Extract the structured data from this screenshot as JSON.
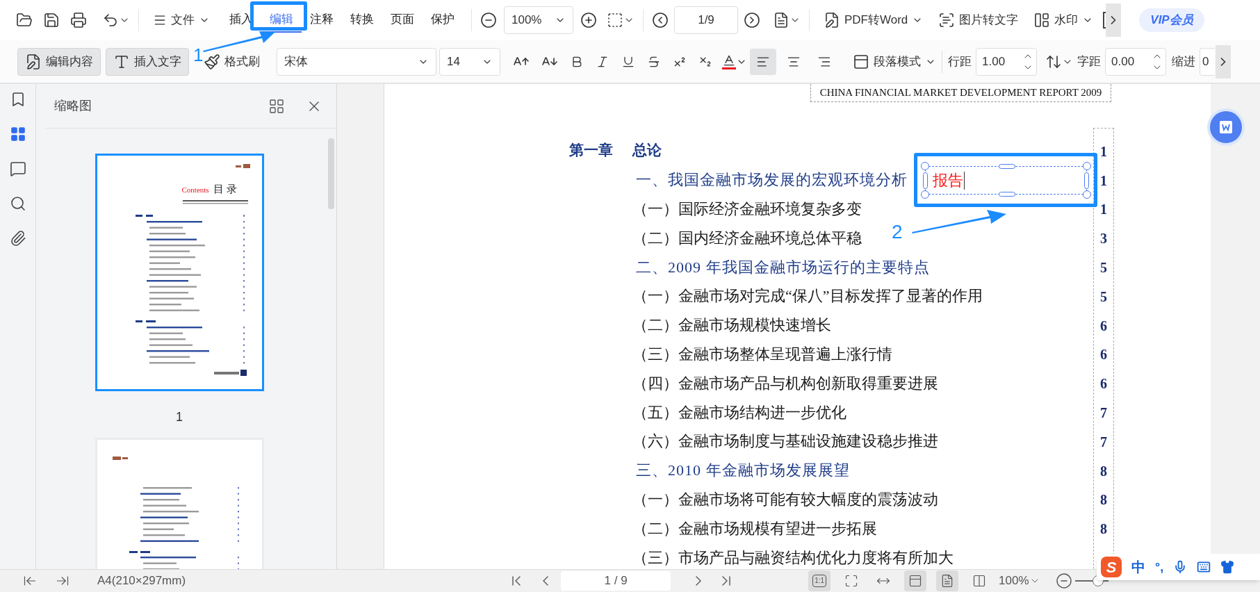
{
  "menu": {
    "label": "文件"
  },
  "tabs": [
    {
      "label": "插入",
      "selected": false
    },
    {
      "label": "编辑",
      "selected": true
    },
    {
      "label": "注释",
      "selected": false
    },
    {
      "label": "转换",
      "selected": false
    },
    {
      "label": "页面",
      "selected": false
    },
    {
      "label": "保护",
      "selected": false
    }
  ],
  "zoom": {
    "value": "100%"
  },
  "page_nav": {
    "value": "1/9"
  },
  "tools": [
    {
      "label": "PDF转Word",
      "kind": "word"
    },
    {
      "label": "图片转文字",
      "kind": "ocr"
    },
    {
      "label": "水印",
      "kind": "watermark"
    }
  ],
  "vip": {
    "label": "VIP会员"
  },
  "edit_bar": {
    "modes": [
      {
        "label": "编辑内容",
        "kind": "edit",
        "pressed": true
      },
      {
        "label": "插入文字",
        "kind": "text",
        "pressed": true
      }
    ],
    "format_painter": "格式刷",
    "font": "宋体",
    "size": "14",
    "alignment": [
      {
        "kind": "left",
        "selected": true
      },
      {
        "kind": "center",
        "selected": false
      },
      {
        "kind": "right",
        "selected": false
      }
    ],
    "paragraph_mode": "段落模式",
    "line_spacing": {
      "label": "行距",
      "value": "1.00"
    },
    "char_spacing": {
      "label": "字距",
      "value": "0.00"
    },
    "indent": {
      "label": "缩进",
      "value": "0"
    }
  },
  "sidebar": {
    "items": [
      {
        "kind": "bookmark",
        "selected": false
      },
      {
        "kind": "thumbnails",
        "selected": true
      },
      {
        "kind": "comments",
        "selected": false
      },
      {
        "kind": "search",
        "selected": false
      },
      {
        "kind": "attachments",
        "selected": false
      }
    ]
  },
  "thumbnail_panel": {
    "title": "缩略图",
    "pages": [
      {
        "label": "1",
        "selected": true,
        "heading": "Contents",
        "heading_cn": "目 录"
      },
      {
        "selected": false
      }
    ]
  },
  "document": {
    "header": "CHINA FINANCIAL MARKET DEVELOPMENT REPORT 2009",
    "toc": [
      {
        "kind": "chapter",
        "number": "第一章",
        "title": "总论",
        "page": "1"
      },
      {
        "kind": "section",
        "title": "一、我国金融市场发展的宏观环境分析",
        "page": "1"
      },
      {
        "kind": "subsection",
        "title": "（一）国际经济金融环境复杂多变",
        "page": "1"
      },
      {
        "kind": "subsection",
        "title": "（二）国内经济金融环境总体平稳",
        "page": "3"
      },
      {
        "kind": "section",
        "title": "二、2009 年我国金融市场运行的主要特点",
        "page": "5"
      },
      {
        "kind": "subsection",
        "title": "（一）金融市场对完成“保八”目标发挥了显著的作用",
        "page": "5"
      },
      {
        "kind": "subsection",
        "title": "（二）金融市场规模快速增长",
        "page": "6"
      },
      {
        "kind": "subsection",
        "title": "（三）金融市场整体呈现普遍上涨行情",
        "page": "6"
      },
      {
        "kind": "subsection",
        "title": "（四）金融市场产品与机构创新取得重要进展",
        "page": "6"
      },
      {
        "kind": "subsection",
        "title": "（五）金融市场结构进一步优化",
        "page": "7"
      },
      {
        "kind": "subsection",
        "title": "（六）金融市场制度与基础设施建设稳步推进",
        "page": "7"
      },
      {
        "kind": "section",
        "title": "三、2010 年金融市场发展展望",
        "page": "8"
      },
      {
        "kind": "subsection",
        "title": "（一）金融市场将可能有较大幅度的震荡波动",
        "page": "8"
      },
      {
        "kind": "subsection",
        "title": "（二）金融市场规模有望进一步拓展",
        "page": "8"
      },
      {
        "kind": "subsection",
        "title": "（三）市场产品与融资结构优化力度将有所加大"
      }
    ],
    "text_box": {
      "value": "报告"
    }
  },
  "status_bar": {
    "paper": "A4(210×297mm)",
    "page": "1 / 9",
    "zoom": "100%",
    "zoom_slider": {
      "level": 0.8
    },
    "views": [
      {
        "kind": "actual",
        "label": "1:1",
        "selected": true
      },
      {
        "kind": "fit-page",
        "selected": false
      },
      {
        "kind": "fit-width",
        "selected": false
      },
      {
        "kind": "continuous",
        "selected": true
      },
      {
        "kind": "single",
        "selected": true
      },
      {
        "kind": "double",
        "selected": false
      }
    ]
  },
  "ime": {
    "logo": "S",
    "mode": "中",
    "punctuation": "°,"
  },
  "annotations": [
    {
      "label": "1"
    },
    {
      "label": "2"
    }
  ]
}
